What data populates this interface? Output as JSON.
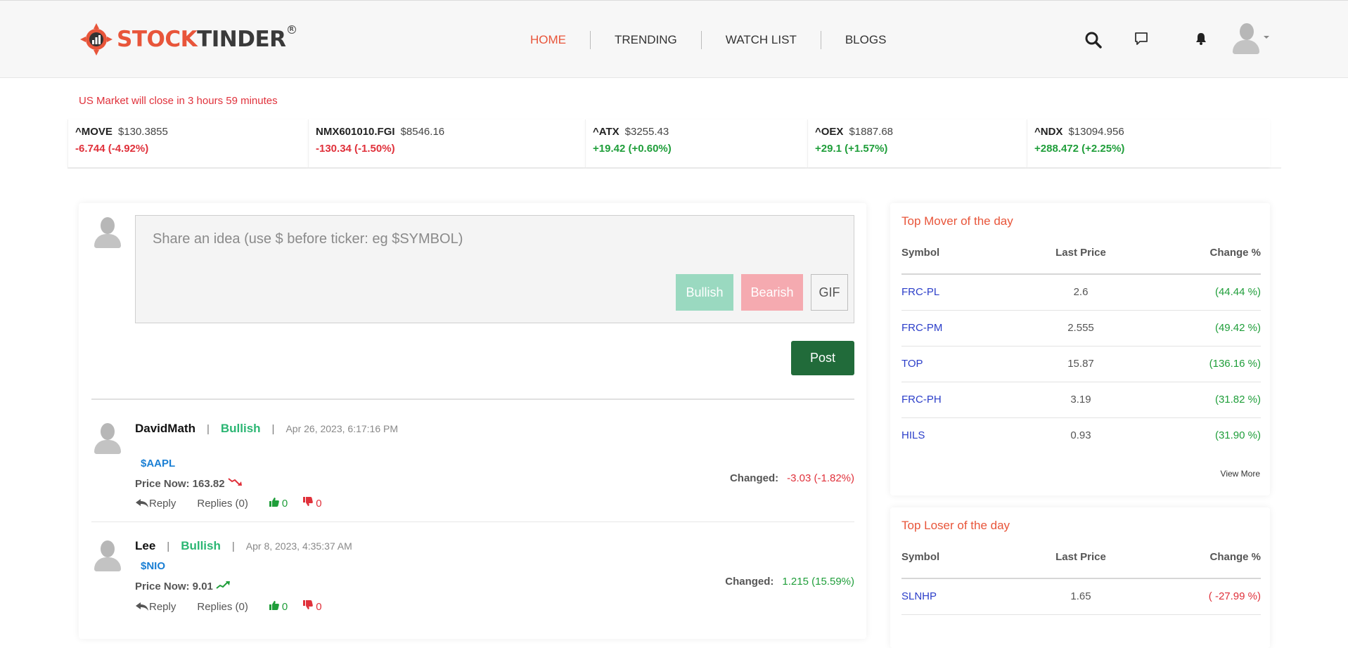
{
  "header": {
    "logo": {
      "word1": "STOCK",
      "word2": "TINDER",
      "reg": "R"
    },
    "nav": [
      {
        "label": "HOME",
        "active": true
      },
      {
        "label": "TRENDING",
        "active": false
      },
      {
        "label": "WATCH LIST",
        "active": false
      },
      {
        "label": "BLOGS",
        "active": false
      }
    ],
    "icons": [
      "search-icon",
      "chat-icon",
      "bell-icon",
      "user-avatar",
      "caret-down-icon"
    ]
  },
  "market": {
    "note": "US Market will close in 3 hours 59 minutes",
    "tickers": [
      {
        "symbol": "^MOVE",
        "price": "$130.3855",
        "change": "-6.744 (-4.92%)",
        "direction": "down"
      },
      {
        "symbol": "NMX601010.FGI",
        "price": "$8546.16",
        "change": "-130.34 (-1.50%)",
        "direction": "down"
      },
      {
        "symbol": "^ATX",
        "price": "$3255.43",
        "change": "+19.42 (+0.60%)",
        "direction": "up"
      },
      {
        "symbol": "^OEX",
        "price": "$1887.68",
        "change": "+29.1 (+1.57%)",
        "direction": "up"
      },
      {
        "symbol": "^NDX",
        "price": "$13094.956",
        "change": "+288.472 (+2.25%)",
        "direction": "up"
      }
    ]
  },
  "composer": {
    "placeholder": "Share an idea (use $ before ticker: eg $SYMBOL)",
    "bullish_label": "Bullish",
    "bearish_label": "Bearish",
    "gif_label": "GIF",
    "post_label": "Post"
  },
  "posts": [
    {
      "user": "DavidMath",
      "sentiment": "Bullish",
      "time": "Apr 26, 2023, 6:17:16 PM",
      "ticker": "$AAPL",
      "price_now": "Price Now: 163.82",
      "trend": "down",
      "changed_label": "Changed:",
      "changed_value": "-3.03 (-1.82%)",
      "changed_direction": "down",
      "reply_label": "Reply",
      "replies_label": "Replies (0)",
      "likes": "0",
      "dislikes": "0"
    },
    {
      "user": "Lee",
      "sentiment": "Bullish",
      "time": "Apr 8, 2023, 4:35:37 AM",
      "ticker": "$NIO",
      "price_now": "Price Now: 9.01",
      "trend": "up",
      "changed_label": "Changed:",
      "changed_value": "1.215 (15.59%)",
      "changed_direction": "up",
      "reply_label": "Reply",
      "replies_label": "Replies (0)",
      "likes": "0",
      "dislikes": "0"
    }
  ],
  "top_movers": {
    "title": "Top Mover of the day",
    "columns": [
      "Symbol",
      "Last Price",
      "Change %"
    ],
    "rows": [
      {
        "symbol": "FRC-PL",
        "price": "2.6",
        "change": "(44.44 %)"
      },
      {
        "symbol": "FRC-PM",
        "price": "2.555",
        "change": "(49.42 %)"
      },
      {
        "symbol": "TOP",
        "price": "15.87",
        "change": "(136.16 %)"
      },
      {
        "symbol": "FRC-PH",
        "price": "3.19",
        "change": "(31.82 %)"
      },
      {
        "symbol": "HILS",
        "price": "0.93",
        "change": "(31.90 %)"
      }
    ],
    "view_more": "View More"
  },
  "top_losers": {
    "title": "Top Loser of the day",
    "columns": [
      "Symbol",
      "Last Price",
      "Change %"
    ],
    "rows": [
      {
        "symbol": "SLNHP",
        "price": "1.65",
        "change": "( -27.99 %)"
      }
    ]
  },
  "colors": {
    "brand": "#e8553a",
    "positive": "#1f9e3a",
    "negative": "#e0313b",
    "link": "#2b3ec9",
    "post_button": "#216b3a"
  }
}
